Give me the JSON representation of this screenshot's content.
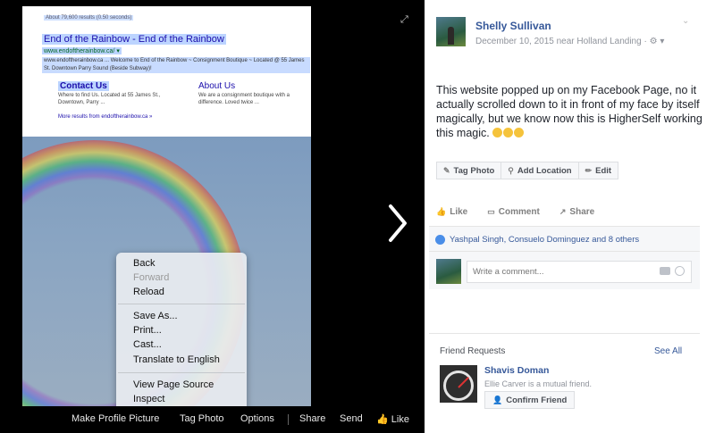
{
  "search_result": {
    "stats": "About 79,600 results (0.50 seconds)",
    "title": "End of the Rainbow - End of the Rainbow",
    "url": "www.endoftherainbow.ca/ ▾",
    "description": "www.endoftherainbow.ca ... Welcome to End of the Rainbow ~ Consignment Boutique ~ Located @ 55 James St. Downtown Parry Sound (Beside Subway)!",
    "sitelinks": [
      {
        "title": "Contact Us",
        "description": "Where to find Us. Located at 55 James St., Downtown, Parry ..."
      },
      {
        "title": "About Us",
        "description": "We are a consignment boutique with a difference. Loved twice ..."
      }
    ],
    "more_results": "More results from endoftherainbow.ca »"
  },
  "context_menu": {
    "back": "Back",
    "forward": "Forward",
    "reload": "Reload",
    "save_as": "Save As...",
    "print": "Print...",
    "cast": "Cast...",
    "translate": "Translate to English",
    "view_source": "View Page Source",
    "inspect": "Inspect"
  },
  "photo_actions": {
    "make_profile": "Make Profile Picture",
    "tag_photo": "Tag Photo",
    "options": "Options",
    "share": "Share",
    "send": "Send",
    "like": "Like"
  },
  "post": {
    "author": "Shelly Sullivan",
    "meta": "December 10, 2015 near Holland Landing · ",
    "text": "This website popped up on my Facebook Page, no it actually scrolled down to it in front of my face by itself magically, but we know now this is HigherSelf working this magic. ",
    "tag_photo": "Tag Photo",
    "add_location": "Add Location",
    "edit": "Edit",
    "like": "Like",
    "comment": "Comment",
    "share": "Share",
    "likers": "Yashpal Singh, Consuelo Dominguez and 8 others",
    "comment_placeholder": "Write a comment..."
  },
  "friend_requests": {
    "heading": "Friend Requests",
    "see_all": "See All",
    "name": "Shavis Doman",
    "mutual": "Ellie Carver is a mutual friend.",
    "confirm": "Confirm Friend"
  },
  "colors": {
    "link": "#365899",
    "viewer_bg": "#000000"
  },
  "icons": [
    "expand-icon",
    "next-arrow-icon",
    "thumbs-up-icon",
    "tag-icon",
    "location-pin-icon",
    "pencil-icon",
    "comment-icon",
    "share-icon",
    "camera-icon",
    "smiley-icon",
    "add-friend-icon"
  ]
}
